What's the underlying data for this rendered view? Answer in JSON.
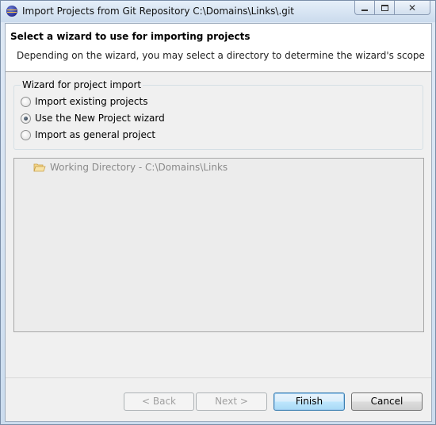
{
  "window": {
    "title": "Import Projects from Git Repository C:\\Domains\\Links\\.git",
    "icon": "eclipse-icon"
  },
  "header": {
    "title": "Select a wizard to use for importing projects",
    "description": "Depending on the wizard, you may select a directory to determine the wizard's scope"
  },
  "wizard_group": {
    "label": "Wizard for project import",
    "options": [
      {
        "label": "Import existing projects",
        "checked": false
      },
      {
        "label": "Use the New Project wizard",
        "checked": true
      },
      {
        "label": "Import as general project",
        "checked": false
      }
    ]
  },
  "tree": {
    "items": [
      {
        "label": "Working Directory - C:\\Domains\\Links",
        "icon": "folder-open-icon",
        "enabled": false
      }
    ]
  },
  "buttons": {
    "back": "< Back",
    "next": "Next >",
    "finish": "Finish",
    "cancel": "Cancel"
  },
  "colors": {
    "default_button_border": "#3c7fb1",
    "disabled_text": "#a0a0a0",
    "dialog_background": "#f0f0f0"
  }
}
